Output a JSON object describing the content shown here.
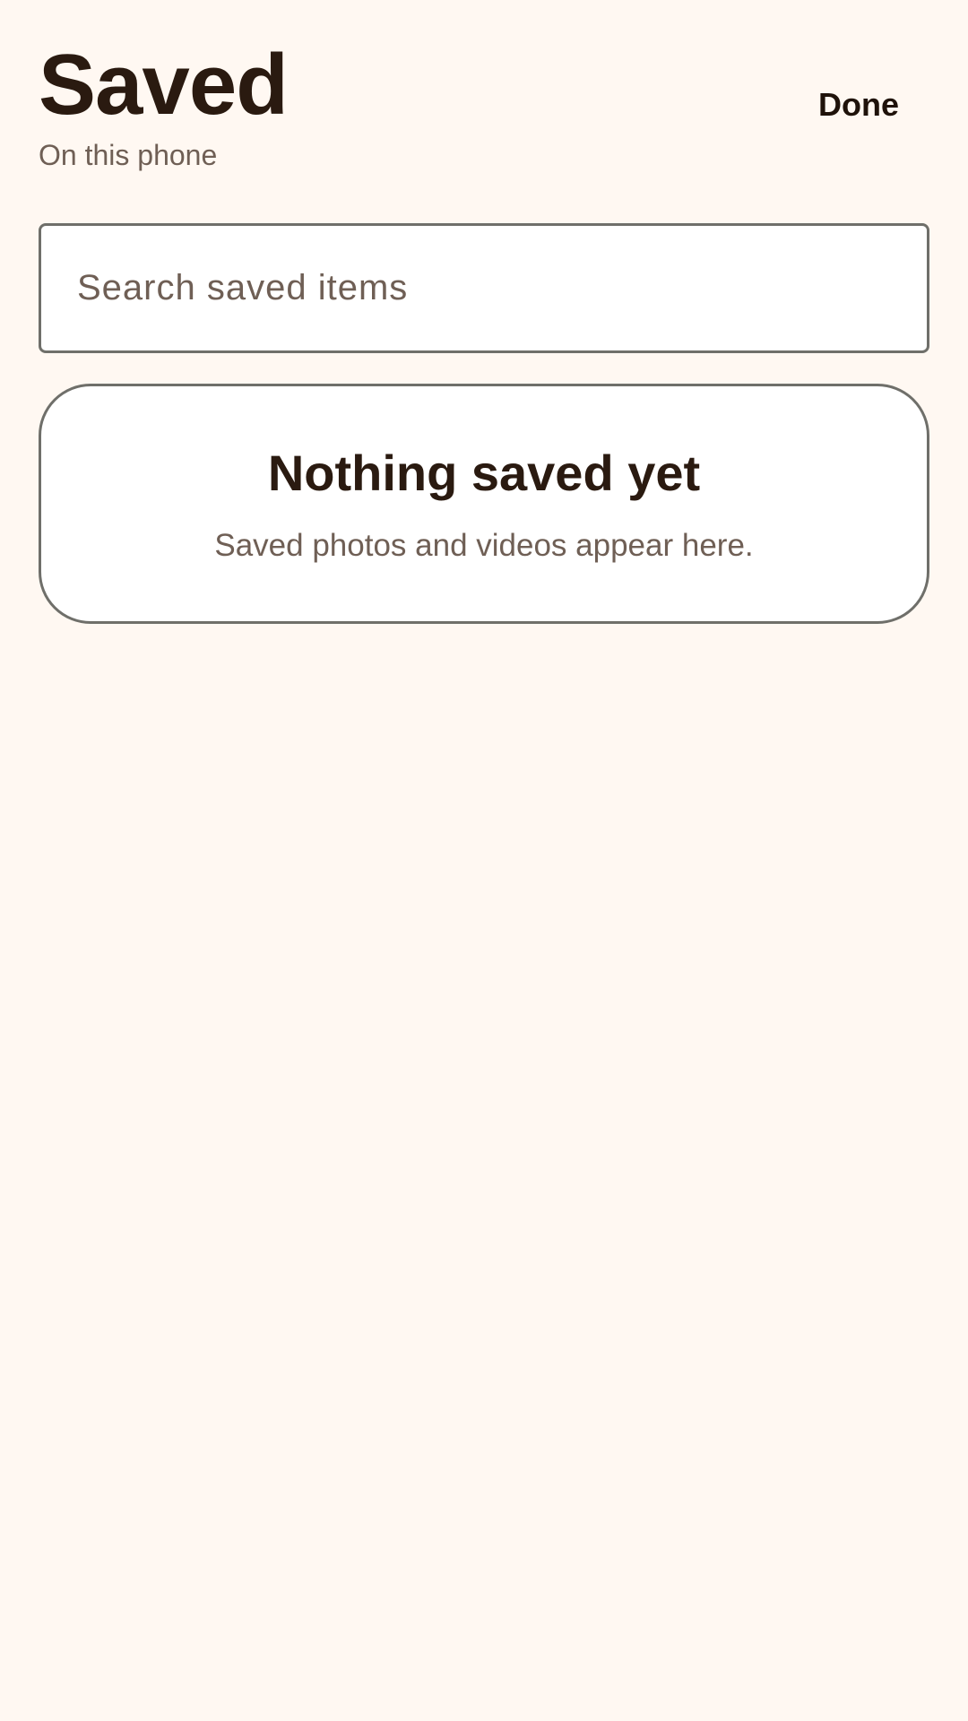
{
  "header": {
    "title": "Saved",
    "subtitle": "On this phone",
    "done_label": "Done"
  },
  "search": {
    "placeholder": "Search saved items",
    "value": ""
  },
  "empty_state": {
    "title": "Nothing saved yet",
    "message": "Saved photos and videos appear here."
  },
  "colors": {
    "background": "#fff8f2",
    "text_primary": "#2a1a10",
    "text_secondary": "#6f5f55",
    "border": "#6f6f6a",
    "surface": "#ffffff"
  }
}
